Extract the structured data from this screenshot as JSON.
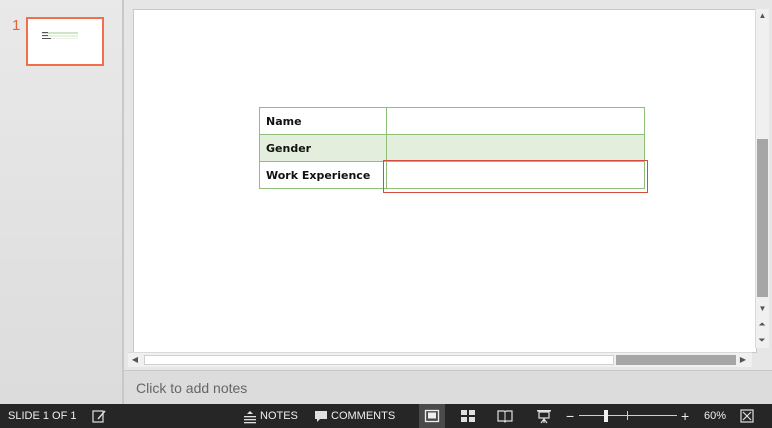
{
  "thumbnails": [
    {
      "number": "1"
    }
  ],
  "slide": {
    "table": [
      {
        "label": "Name",
        "value": ""
      },
      {
        "label": "Gender",
        "value": ""
      },
      {
        "label": "Work Experience",
        "value": ""
      }
    ]
  },
  "notes": {
    "placeholder": "Click to add notes"
  },
  "statusbar": {
    "slide_indicator": "SLIDE 1 OF 1",
    "notes_label": "NOTES",
    "comments_label": "COMMENTS",
    "zoom_minus": "−",
    "zoom_plus": "+",
    "zoom_level": "60%"
  },
  "colors": {
    "accent": "#f0704e",
    "table_border": "#8fc07a",
    "table_shade": "#e3efdc",
    "selection": "#d44b3f",
    "statusbar_bg": "#262626"
  },
  "icons": [
    "spell-check-icon",
    "notes-icon",
    "comments-icon",
    "normal-view-icon",
    "slide-sorter-icon",
    "reading-view-icon",
    "slideshow-icon",
    "fit-slide-icon"
  ]
}
